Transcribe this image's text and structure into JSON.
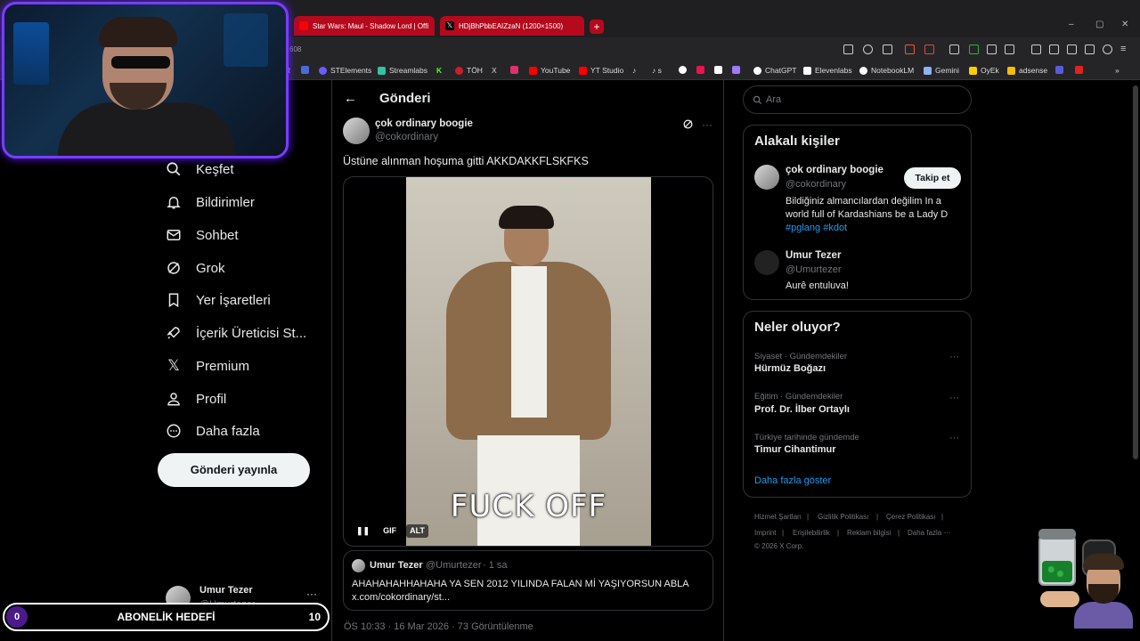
{
  "browser": {
    "tabs": [
      {
        "title": "Star Wars: Maul - Shadow Lord | Offi",
        "favicon_color": "#ff0000"
      },
      {
        "title": "HDjBhPbbEAIZzaN (1200×1500)",
        "favicon_color": "#000000"
      }
    ],
    "new_tab_label": "+",
    "window_controls": {
      "minimize": "–",
      "maximize": "▢",
      "close": "✕"
    },
    "address_fragment": "608",
    "bookmarks": [
      {
        "label": "R",
        "color": "#4b6cd8"
      },
      {
        "label": "STElements",
        "color": "#6a5cff"
      },
      {
        "label": "Streamlabs",
        "color": "#31c3a2"
      },
      {
        "label": "K",
        "color": "#53fc18"
      },
      {
        "label": "TÖH",
        "color": "#d11a2a"
      },
      {
        "label": "X",
        "color": "#ffffff"
      },
      {
        "label": "",
        "color": "#e1306c"
      },
      {
        "label": "YouTube",
        "color": "#ff0000"
      },
      {
        "label": "YT Studio",
        "color": "#ff0000"
      },
      {
        "label": "♪",
        "color": "#ffffff"
      },
      {
        "label": "♪ s",
        "color": "#ffffff"
      },
      {
        "label": "ChatGPT",
        "color": "#ffffff"
      },
      {
        "label": "Elevenlabs",
        "color": "#ffffff"
      },
      {
        "label": "NotebookLM",
        "color": "#ffffff"
      },
      {
        "label": "Gemini",
        "color": "#8ab4f8"
      },
      {
        "label": "OyEk",
        "color": "#ffcc00"
      },
      {
        "label": "adsense",
        "color": "#fbbc04"
      }
    ]
  },
  "nav": {
    "items": [
      {
        "label": "Keşfet",
        "icon": "search-icon"
      },
      {
        "label": "Bildirimler",
        "icon": "bell-icon"
      },
      {
        "label": "Sohbet",
        "icon": "mail-icon"
      },
      {
        "label": "Grok",
        "icon": "grok-icon"
      },
      {
        "label": "Yer İşaretleri",
        "icon": "bookmark-icon"
      },
      {
        "label": "İçerik Üreticisi St...",
        "icon": "rocket-icon"
      },
      {
        "label": "Premium",
        "icon": "x-logo-icon"
      },
      {
        "label": "Profil",
        "icon": "person-icon"
      },
      {
        "label": "Daha fazla",
        "icon": "more-circle-icon"
      }
    ],
    "post_button": "Gönderi yayınla",
    "account": {
      "name": "Umur Tezer",
      "handle": "@Umurtezer",
      "more": "···"
    }
  },
  "goal": {
    "left": "0",
    "title": "ABONELİK HEDEFİ",
    "right": "10"
  },
  "header": {
    "back": "←",
    "title": "Gönderi"
  },
  "post": {
    "name": "çok ordinary boogie",
    "handle": "@cokordinary",
    "text": "Üstüne alınman hoşuma gitti AKKDAKKFLSKFKS",
    "gif_caption": "FUCK OFF",
    "media_controls": {
      "pause": "❚❚",
      "gif": "GIF",
      "alt": "ALT"
    },
    "more": "···",
    "quote": {
      "name": "Umur Tezer",
      "handle": "@Umurtezer",
      "time": "· 1 sa",
      "text": "AHAHAHAHHAHAHA YA SEN 2012 YILINDA FALAN Mİ YAŞIYORSUN ABLA x.com/cokordinary/st..."
    },
    "meta": "ÖS 10:33 · 16 Mar 2026 · 73 Görüntülenme"
  },
  "right": {
    "search_placeholder": "Ara",
    "related_title": "Alakalı kişiler",
    "related": [
      {
        "name": "çok ordinary boogie",
        "handle": "@cokordinary",
        "bio": "Bildiğiniz almancılardan değilim In a world full of Kardashians be a Lady D",
        "tags": "#pglang #kdot",
        "follow": "Takip et"
      },
      {
        "name": "Umur Tezer",
        "handle": "@Umurtezer",
        "bio": "Aurê entuluva!"
      }
    ],
    "trends_title": "Neler oluyor?",
    "trends": [
      {
        "category": "Siyaset · Gündemdekiler",
        "name": "Hürmüz Boğazı"
      },
      {
        "category": "Eğitim · Gündemdekiler",
        "name": "Prof. Dr. İlber Ortaylı"
      },
      {
        "category": "Türkiye tarihinde gündemde",
        "name": "Timur Cihantimur"
      }
    ],
    "show_more": "Daha fazla göster",
    "footer": {
      "row1": [
        "Hizmet Şartları",
        "|",
        "Gizlilik Politikası",
        "|",
        "Çerez Politikası",
        "|"
      ],
      "row2": [
        "Imprint",
        "|",
        "Erişilebilirlik",
        "|",
        "Reklam bilgisi",
        "|",
        "Daha fazla ···"
      ],
      "copyright": "© 2026 X Corp."
    }
  }
}
